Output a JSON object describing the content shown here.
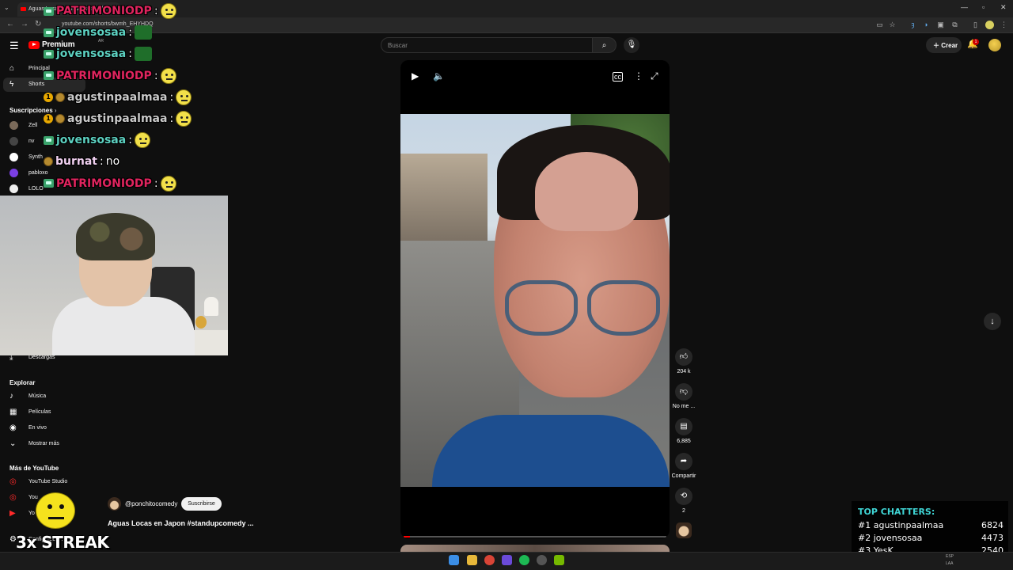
{
  "browser": {
    "tab_title": "Aguas Locas en Japon #stand",
    "url": "youtube.com/shorts/bwmh_EHYHDQ"
  },
  "header": {
    "logo_text": "Premium",
    "logo_sup": "AR",
    "search_placeholder": "Buscar",
    "create_label": "Crear",
    "notification_count": "1"
  },
  "sidebar": {
    "nav": [
      {
        "label": "Principal",
        "icon": "home-icon"
      },
      {
        "label": "Shorts",
        "icon": "shorts-icon"
      }
    ],
    "subscriptions_title": "Suscripciones",
    "subscriptions": [
      {
        "label": "Zell",
        "color": "#7a6a5a"
      },
      {
        "label": "nv",
        "color": "#444444"
      },
      {
        "label": "Synth",
        "color": "#ffffff"
      },
      {
        "label": "pabloxo",
        "color": "#7b3fe4"
      },
      {
        "label": "LOLO",
        "color": "#eeeeee"
      }
    ],
    "downloads_label": "Descargas",
    "explore_title": "Explorar",
    "explore": [
      {
        "label": "Música",
        "icon": "music-icon"
      },
      {
        "label": "Películas",
        "icon": "film-icon"
      },
      {
        "label": "En vivo",
        "icon": "live-icon"
      },
      {
        "label": "Mostrar más",
        "icon": "chevron-down-icon"
      }
    ],
    "more_title": "Más de YouTube",
    "more": [
      {
        "label": "YouTube Studio"
      },
      {
        "label": "You"
      },
      {
        "label": "Yo"
      }
    ],
    "config_label": "Configuración"
  },
  "chat": [
    {
      "user": "PATRIMONIODP",
      "color": "#e0245e",
      "badge": "sub",
      "msg": "",
      "emote": "face"
    },
    {
      "user": "jovensosaa",
      "color": "#5cd0c0",
      "badge": "sub",
      "msg": "",
      "emote": "frog"
    },
    {
      "user": "jovensosaa",
      "color": "#5cd0c0",
      "badge": "sub",
      "msg": "",
      "emote": "frog"
    },
    {
      "user": "PATRIMONIODP",
      "color": "#e0245e",
      "badge": "sub",
      "msg": "",
      "emote": "face"
    },
    {
      "user": "agustinpaalmaa",
      "color": "#c9c9c9",
      "badge": "num",
      "msg": "",
      "emote": "face"
    },
    {
      "user": "agustinpaalmaa",
      "color": "#c9c9c9",
      "badge": "num",
      "msg": "",
      "emote": "face"
    },
    {
      "user": "jovensosaa",
      "color": "#5cd0c0",
      "badge": "sub",
      "msg": "",
      "emote": "face"
    },
    {
      "user": "burnat",
      "color": "#f0d0f0",
      "badge": "coin",
      "msg": "no",
      "emote": ""
    },
    {
      "user": "PATRIMONIODP",
      "color": "#e0245e",
      "badge": "sub",
      "msg": "",
      "emote": "face"
    }
  ],
  "video": {
    "channel": "@ponchitocomedy",
    "subscribe_label": "Suscribirse",
    "title": "Aguas Locas en Japon #standupcomedy ...",
    "progress": 0.025
  },
  "actions": [
    {
      "icon": "like-icon",
      "label": "204 k"
    },
    {
      "icon": "dislike-icon",
      "label": "No me ..."
    },
    {
      "icon": "comment-icon",
      "label": "6,885"
    },
    {
      "icon": "share-icon",
      "label": "Compartir"
    },
    {
      "icon": "remix-icon",
      "label": "2"
    }
  ],
  "streak": {
    "text": "3x STREAK"
  },
  "top_chatters": {
    "title": "TOP CHATTERS:",
    "rows": [
      {
        "rank": "#1",
        "name": "agustinpaalmaa",
        "count": "6824"
      },
      {
        "rank": "#2",
        "name": "jovensosaa",
        "count": "4473"
      },
      {
        "rank": "#3",
        "name": "YesK",
        "count": "2540"
      }
    ]
  },
  "taskbar": {
    "lang": "ESP",
    "lang_sub": "LAA"
  }
}
